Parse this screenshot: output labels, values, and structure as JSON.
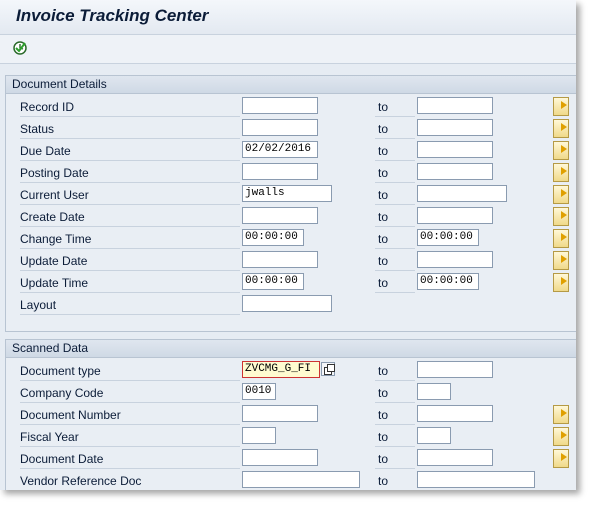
{
  "window": {
    "title": "Invoice Tracking Center"
  },
  "toolbar": {
    "execute_icon": "execute-clock-icon"
  },
  "to_label": "to",
  "sections": {
    "document_details": {
      "title": "Document Details",
      "rows": [
        {
          "label": "Record ID",
          "low": "",
          "high": "",
          "multi": true
        },
        {
          "label": "Status",
          "low": "",
          "high": "",
          "multi": true
        },
        {
          "label": "Due Date",
          "low": "02/02/2016",
          "high": "",
          "multi": true
        },
        {
          "label": "Posting Date",
          "low": "",
          "high": "",
          "multi": true
        },
        {
          "label": "Current User",
          "low": "jwalls",
          "high": "",
          "multi": true
        },
        {
          "label": "Create Date",
          "low": "",
          "high": "",
          "multi": true
        },
        {
          "label": "Change Time",
          "low": "00:00:00",
          "high": "00:00:00",
          "multi": true
        },
        {
          "label": "Update Date",
          "low": "",
          "high": "",
          "multi": true
        },
        {
          "label": "Update Time",
          "low": "00:00:00",
          "high": "00:00:00",
          "multi": true
        },
        {
          "label": "Layout",
          "low": ""
        }
      ]
    },
    "scanned_data": {
      "title": "Scanned Data",
      "rows": [
        {
          "label": "Document type",
          "low": "ZVCMG_G_FI",
          "high": "",
          "multi": false
        },
        {
          "label": "Company Code",
          "low": "0010",
          "high": "",
          "multi": false
        },
        {
          "label": "Document Number",
          "low": "",
          "high": "",
          "multi": true
        },
        {
          "label": "Fiscal Year",
          "low": "",
          "high": "",
          "multi": true
        },
        {
          "label": "Document Date",
          "low": "",
          "high": "",
          "multi": true
        },
        {
          "label": "Vendor Reference Doc",
          "low": "",
          "high": "",
          "multi": true
        }
      ]
    }
  }
}
